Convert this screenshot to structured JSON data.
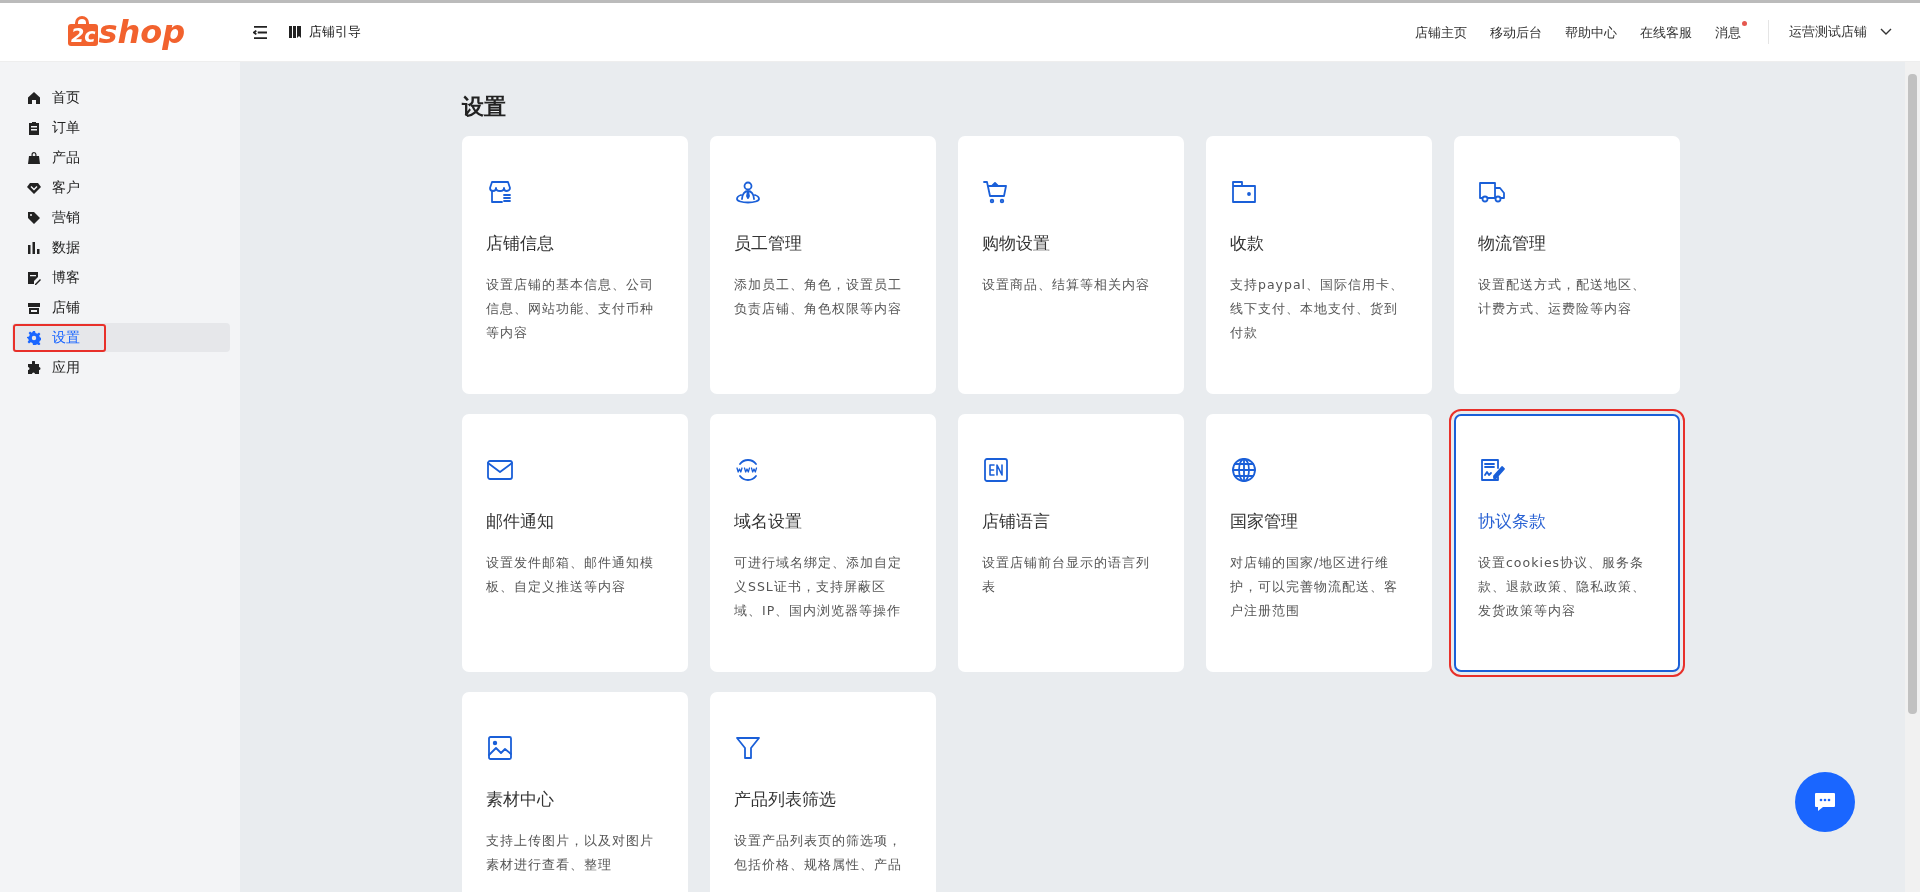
{
  "header": {
    "logo": {
      "mark": "2c",
      "text": "shop"
    },
    "guide": "店铺引导",
    "links": [
      {
        "label": "店铺主页",
        "unread": false
      },
      {
        "label": "移动后台",
        "unread": false
      },
      {
        "label": "帮助中心",
        "unread": false
      },
      {
        "label": "在线客服",
        "unread": false
      },
      {
        "label": "消息",
        "unread": true
      }
    ],
    "store": "运营测试店铺"
  },
  "sidebar": {
    "items": [
      {
        "label": "首页",
        "selected": false,
        "highlighted": false
      },
      {
        "label": "订单",
        "selected": false,
        "highlighted": false
      },
      {
        "label": "产品",
        "selected": false,
        "highlighted": false
      },
      {
        "label": "客户",
        "selected": false,
        "highlighted": false
      },
      {
        "label": "营销",
        "selected": false,
        "highlighted": false
      },
      {
        "label": "数据",
        "selected": false,
        "highlighted": false
      },
      {
        "label": "博客",
        "selected": false,
        "highlighted": false
      },
      {
        "label": "店铺",
        "selected": false,
        "highlighted": false
      },
      {
        "label": "设置",
        "selected": true,
        "highlighted": true
      },
      {
        "label": "应用",
        "selected": false,
        "highlighted": false
      }
    ]
  },
  "page_title": "设置",
  "cards": [
    {
      "title": "店铺信息",
      "description": "设置店铺的基本信息、公司信息、网站功能、支付币种等内容",
      "selected": false,
      "highlighted": false
    },
    {
      "title": "员工管理",
      "description": "添加员工、角色，设置员工负责店铺、角色权限等内容",
      "selected": false,
      "highlighted": false
    },
    {
      "title": "购物设置",
      "description": "设置商品、结算等相关内容",
      "selected": false,
      "highlighted": false
    },
    {
      "title": "收款",
      "description": "支持paypal、国际信用卡、线下支付、本地支付、货到付款",
      "selected": false,
      "highlighted": false
    },
    {
      "title": "物流管理",
      "description": "设置配送方式，配送地区、计费方式、运费险等内容",
      "selected": false,
      "highlighted": false
    },
    {
      "title": "邮件通知",
      "description": "设置发件邮箱、邮件通知模板、自定义推送等内容",
      "selected": false,
      "highlighted": false
    },
    {
      "title": "域名设置",
      "description": "可进行域名绑定、添加自定义SSL证书，支持屏蔽区域、IP、国内浏览器等操作",
      "selected": false,
      "highlighted": false
    },
    {
      "title": "店铺语言",
      "description": "设置店铺前台显示的语言列表",
      "selected": false,
      "highlighted": false
    },
    {
      "title": "国家管理",
      "description": "对店铺的国家/地区进行维护，可以完善物流配送、客户注册范围",
      "selected": false,
      "highlighted": false
    },
    {
      "title": "协议条款",
      "description": "设置cookies协议、服务条款、退款政策、隐私政策、发货政策等内容",
      "selected": true,
      "highlighted": true
    },
    {
      "title": "素材中心",
      "description": "支持上传图片，以及对图片素材进行查看、整理",
      "selected": false,
      "highlighted": false
    },
    {
      "title": "产品列表筛选",
      "description": "设置产品列表页的筛选项，包括价格、规格属性、产品",
      "selected": false,
      "highlighted": false
    }
  ]
}
